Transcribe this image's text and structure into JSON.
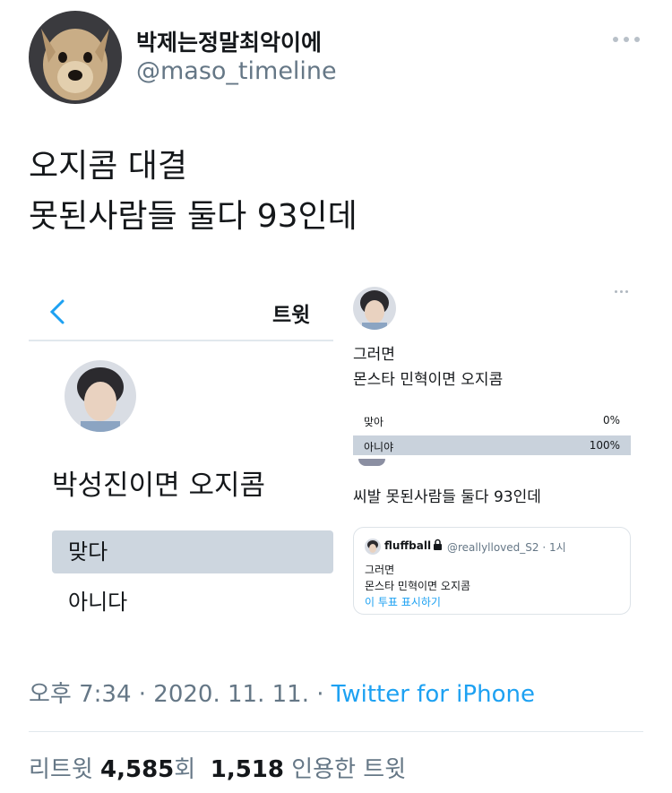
{
  "author": {
    "display_name": "박제는정말최악이에",
    "handle": "@maso_timeline"
  },
  "tweet": {
    "lines": [
      "오지콤 대결",
      "못된사람들 둘다 93인데"
    ]
  },
  "media_left": {
    "header_title": "트윗",
    "poll_question": "박성진이면 오지콤",
    "options": [
      "맞다",
      "아니다"
    ]
  },
  "media_right": {
    "text_lines": [
      "그러면",
      "몬스타 민혁이면 오지콤"
    ],
    "poll": [
      {
        "label": "맞아",
        "percent": "0%"
      },
      {
        "label": "아니야",
        "percent": "100%"
      }
    ],
    "reply_text": "씨발 못된사람들 둘다 93인데",
    "quote": {
      "name": "fluffball",
      "handle": "@reallylloved_S2 · 1시",
      "lines": [
        "그러면",
        "몬스타 민혁이면 오지콤"
      ],
      "link": "이 투표 표시하기"
    }
  },
  "meta": {
    "time": "오후 7:34",
    "date": "2020. 11. 11.",
    "source": "Twitter for iPhone"
  },
  "stats": {
    "retweet_label": "리트윗",
    "retweet_count": "4,585",
    "retweet_unit": "회",
    "quote_count": "1,518",
    "quote_label": "인용한 트윗"
  },
  "colors": {
    "accent": "#1da1f2",
    "secondary_text": "#657786",
    "poll_fill": "#cdd6df"
  }
}
